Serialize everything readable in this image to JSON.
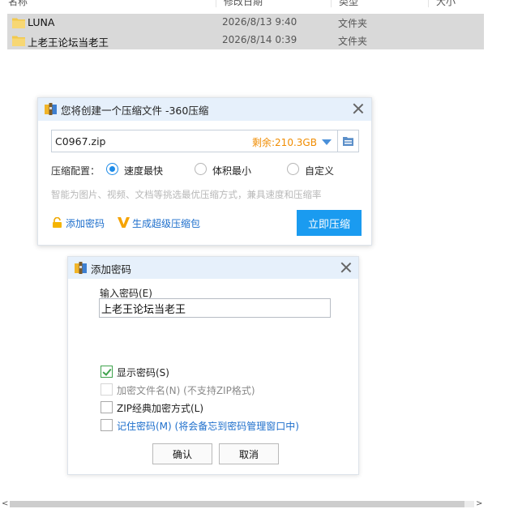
{
  "explorer": {
    "columns": [
      "名称",
      "修改日期",
      "类型",
      "大小"
    ],
    "rows": [
      {
        "name": "LUNA",
        "date": "2026/8/13 9:40",
        "type": "文件夹"
      },
      {
        "name": "上老王论坛当老王",
        "date": "2026/8/14 0:39",
        "type": "文件夹"
      }
    ]
  },
  "compress_dialog": {
    "title": "您将创建一个压缩文件 -360压缩",
    "filename": "C0967.zip",
    "free_space": "剩余:210.3GB",
    "config_label": "压缩配置：",
    "options": [
      {
        "label": "速度最快",
        "selected": true
      },
      {
        "label": "体积最小",
        "selected": false
      },
      {
        "label": "自定义",
        "selected": false
      }
    ],
    "hint": "智能为图片、视频、文档等挑选最优压缩方式，兼具速度和压缩率",
    "add_password_link": "添加密码",
    "super_link": "生成超级压缩包",
    "compress_button": "立即压缩"
  },
  "password_dialog": {
    "title": "添加密码",
    "input_label": "输入密码(E)",
    "password_value": "上老王论坛当老王",
    "checkboxes": [
      {
        "label": "显示密码(S)",
        "checked": true,
        "disabled": false
      },
      {
        "label": "加密文件名(N) (不支持ZIP格式)",
        "checked": false,
        "disabled": true
      },
      {
        "label": "ZIP经典加密方式(L)",
        "checked": false,
        "disabled": false
      },
      {
        "label": "记住密码(M) (将会备忘到密码管理窗口中)",
        "checked": false,
        "disabled": false
      }
    ],
    "ok_button": "确认",
    "cancel_button": "取消"
  },
  "colors": {
    "accent_blue": "#1a9bf0",
    "title_bar": "#e6f0fb",
    "free_space_orange": "#f08c00",
    "link_blue": "#1e6fcc",
    "check_green": "#3fa34d",
    "selected_row": "#d9d9d9"
  }
}
